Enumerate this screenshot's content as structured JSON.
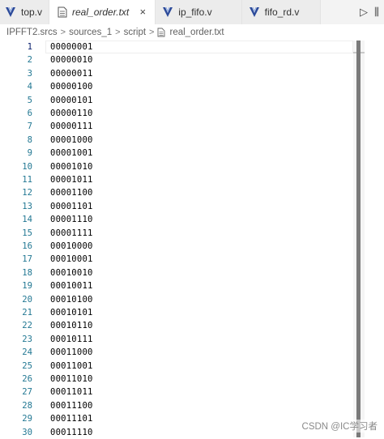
{
  "tabs": [
    {
      "label": "top.v",
      "icon": "verilog-file-icon",
      "active": false,
      "italic": false
    },
    {
      "label": "real_order.txt",
      "icon": "text-file-icon",
      "active": true,
      "italic": true,
      "close": "×"
    },
    {
      "label": "ip_fifo.v",
      "icon": "verilog-file-icon",
      "active": false,
      "italic": false
    },
    {
      "label": "fifo_rd.v",
      "icon": "verilog-file-icon",
      "active": false,
      "italic": false
    }
  ],
  "actions": {
    "run": "▷",
    "split": "⫼"
  },
  "breadcrumb": [
    "IPFFT2.srcs",
    "sources_1",
    "script",
    "real_order.txt"
  ],
  "breadcrumb_separator": ">",
  "lines": [
    {
      "n": "1",
      "text": "00000001"
    },
    {
      "n": "2",
      "text": "00000010"
    },
    {
      "n": "3",
      "text": "00000011"
    },
    {
      "n": "4",
      "text": "00000100"
    },
    {
      "n": "5",
      "text": "00000101"
    },
    {
      "n": "6",
      "text": "00000110"
    },
    {
      "n": "7",
      "text": "00000111"
    },
    {
      "n": "8",
      "text": "00001000"
    },
    {
      "n": "9",
      "text": "00001001"
    },
    {
      "n": "10",
      "text": "00001010"
    },
    {
      "n": "11",
      "text": "00001011"
    },
    {
      "n": "12",
      "text": "00001100"
    },
    {
      "n": "13",
      "text": "00001101"
    },
    {
      "n": "14",
      "text": "00001110"
    },
    {
      "n": "15",
      "text": "00001111"
    },
    {
      "n": "16",
      "text": "00010000"
    },
    {
      "n": "17",
      "text": "00010001"
    },
    {
      "n": "18",
      "text": "00010010"
    },
    {
      "n": "19",
      "text": "00010011"
    },
    {
      "n": "20",
      "text": "00010100"
    },
    {
      "n": "21",
      "text": "00010101"
    },
    {
      "n": "22",
      "text": "00010110"
    },
    {
      "n": "23",
      "text": "00010111"
    },
    {
      "n": "24",
      "text": "00011000"
    },
    {
      "n": "25",
      "text": "00011001"
    },
    {
      "n": "26",
      "text": "00011010"
    },
    {
      "n": "27",
      "text": "00011011"
    },
    {
      "n": "28",
      "text": "00011100"
    },
    {
      "n": "29",
      "text": "00011101"
    },
    {
      "n": "30",
      "text": "00011110"
    }
  ],
  "watermark": "CSDN @IC学习者",
  "colors": {
    "line_number": "#237893",
    "line_number_active": "#0b216f",
    "verilog_icon": "#2b4a9a"
  }
}
